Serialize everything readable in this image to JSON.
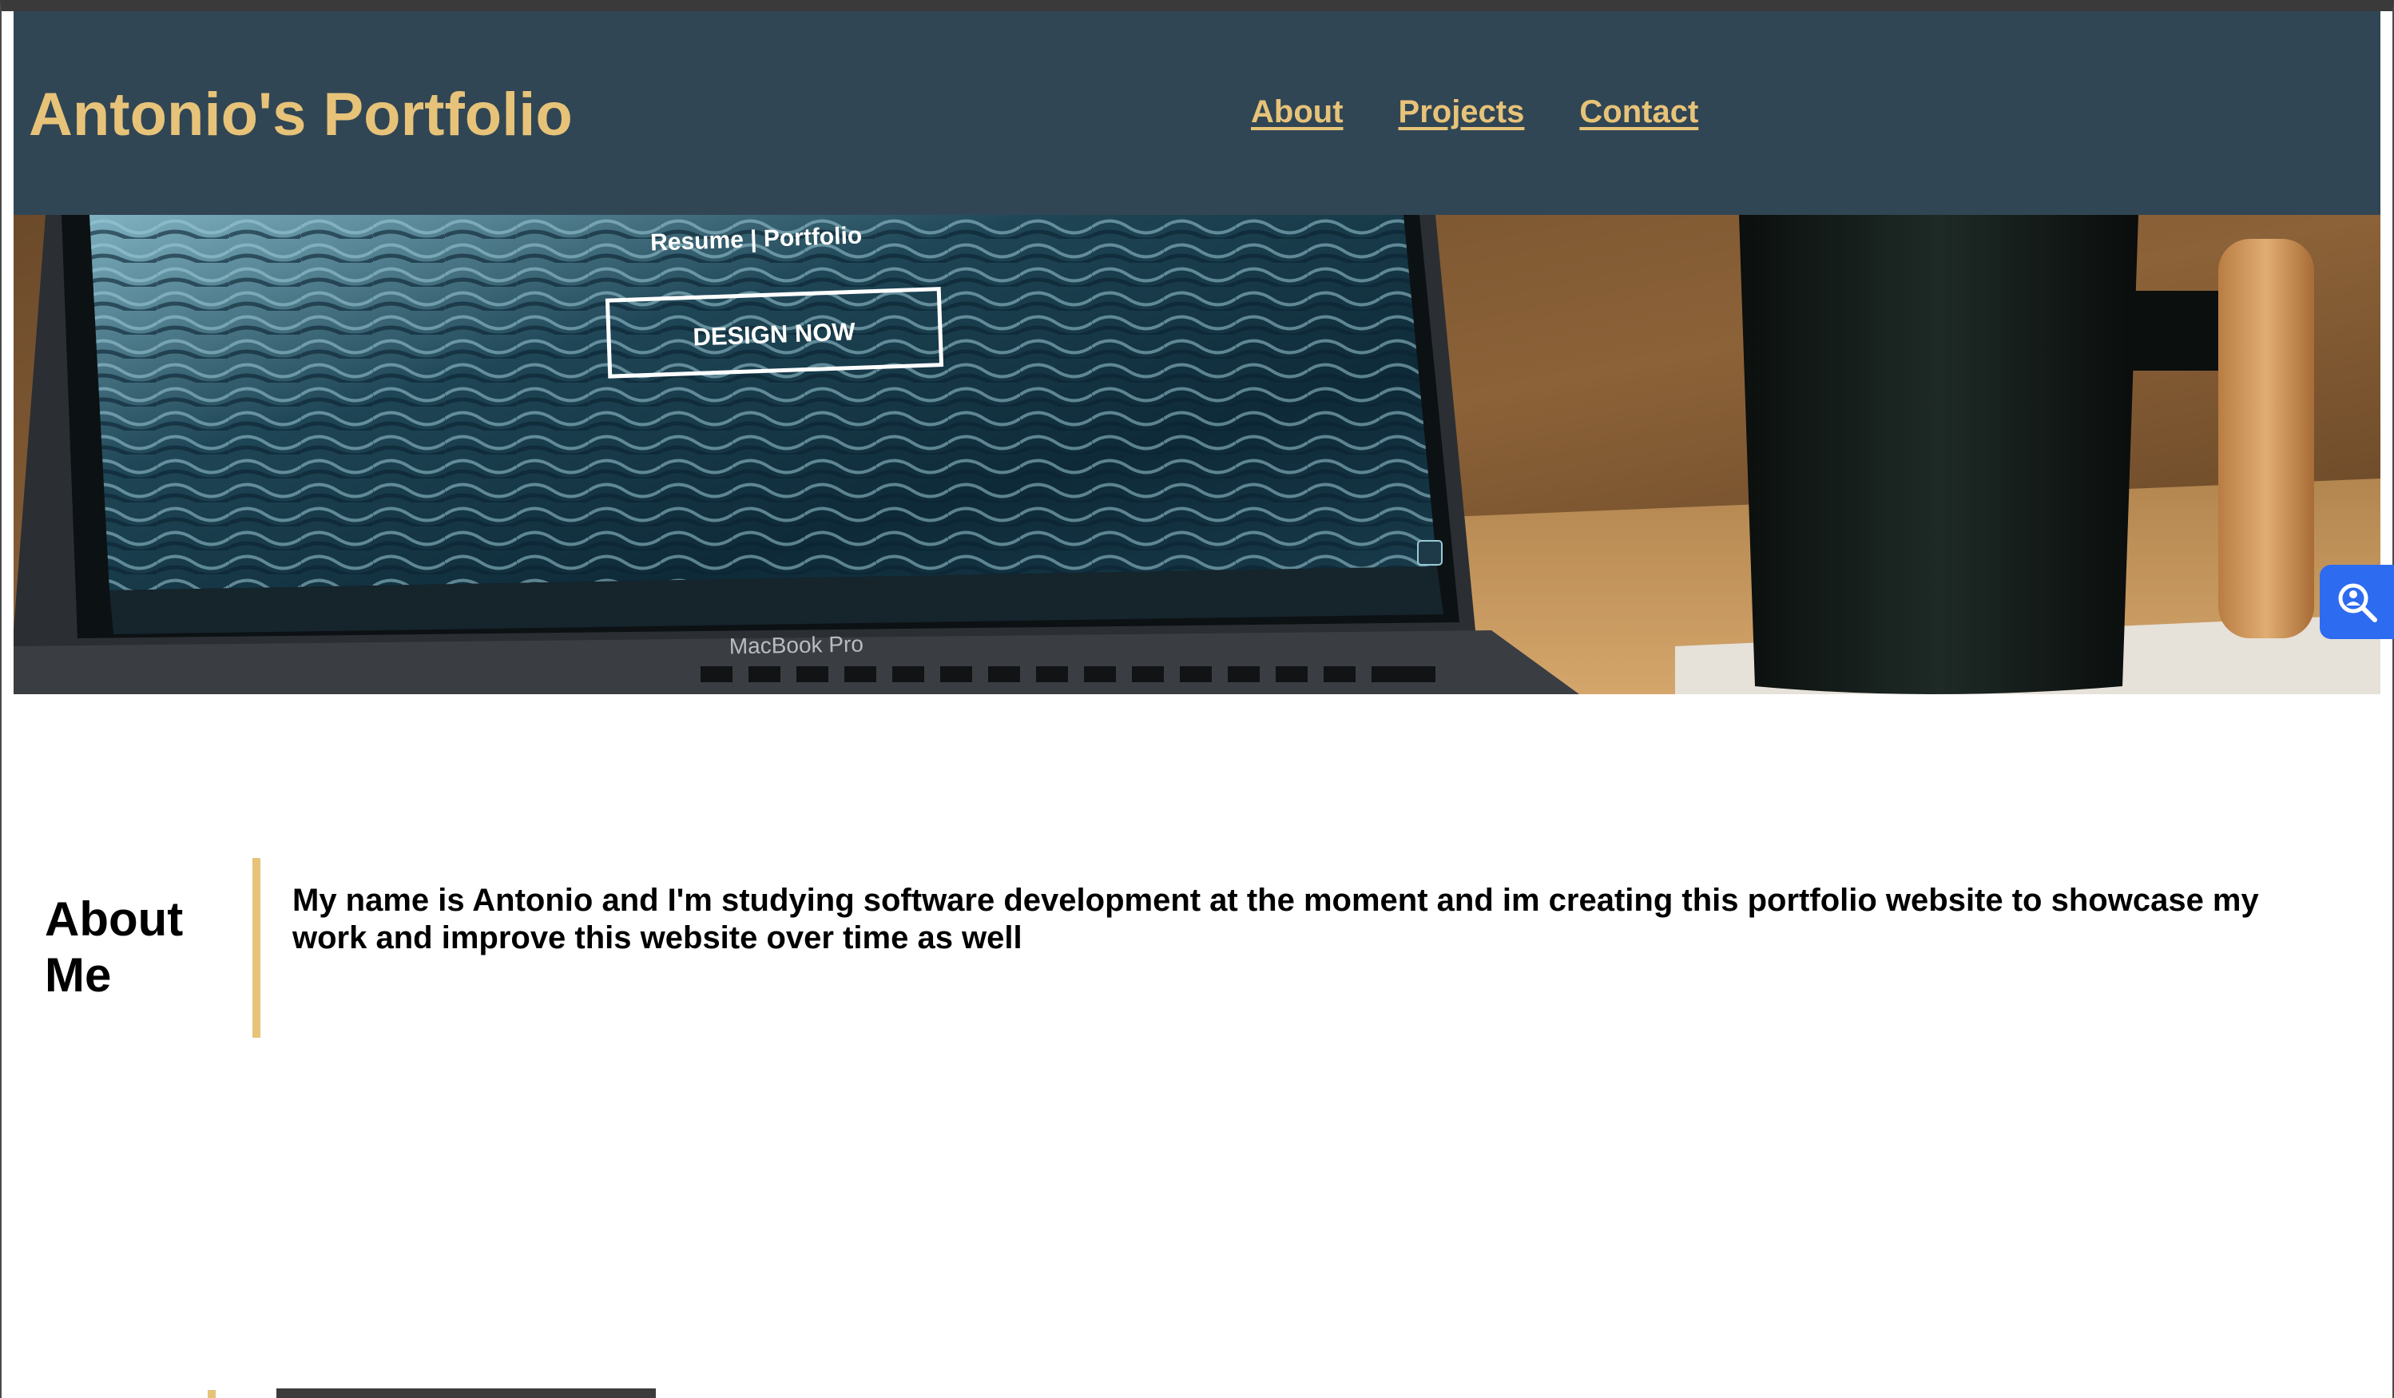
{
  "header": {
    "brand": "Antonio's Portfolio",
    "nav": [
      "About",
      "Projects",
      "Contact"
    ],
    "background_color": "#314654",
    "accent_color": "#e7c379"
  },
  "hero": {
    "screen_text": "Resume | Portfolio",
    "screen_button": "DESIGN NOW",
    "laptop_label": "MacBook Pro"
  },
  "about": {
    "title": "About Me",
    "text": "My name is Antonio and I'm studying software development at the moment and im creating this portfolio website to showcase my work and improve this website over time as well"
  },
  "widgets": {
    "accessibility_icon": "magnifier-person-icon",
    "accessibility_color": "#2d6bf0"
  }
}
